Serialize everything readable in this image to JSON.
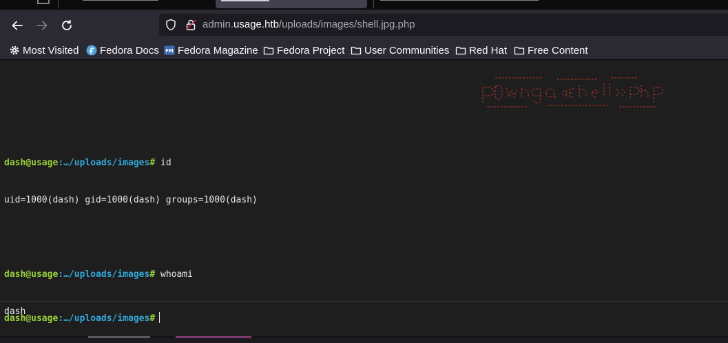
{
  "browser": {
    "url_prefix": "admin.",
    "url_host": "usage.htb",
    "url_path": "/uploads/images/shell.jpg.php"
  },
  "bookmarks": [
    {
      "label": "Most Visited",
      "icon": "gear-icon"
    },
    {
      "label": "Fedora Docs",
      "icon": "fedora-icon"
    },
    {
      "label": "Fedora Magazine",
      "icon": "fedora-magazine-icon"
    },
    {
      "label": "Fedora Project",
      "icon": "folder-icon"
    },
    {
      "label": "User Communities",
      "icon": "folder-icon"
    },
    {
      "label": "Red Hat",
      "icon": "folder-icon"
    },
    {
      "label": "Free Content",
      "icon": "folder-icon"
    }
  ],
  "shell": {
    "user_host": "dash@usage",
    "path": ":…/uploads/images",
    "hash": "#",
    "cmd1": "id",
    "out1": "uid=1000(dash) gid=1000(dash) groups=1000(dash)",
    "cmd2": "whoami",
    "out2": "dash"
  },
  "colors": {
    "prompt_user": "#99d03a",
    "prompt_path": "#33a7d8",
    "ascii_banner": "#c0392b"
  }
}
